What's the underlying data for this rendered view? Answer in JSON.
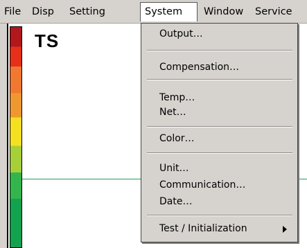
{
  "menubar": {
    "items": [
      "File",
      "Disp",
      "Setting",
      "System",
      "Window",
      "Service"
    ],
    "open_item": "System"
  },
  "display": {
    "label": "TS",
    "color_scale": [
      "#b0181c",
      "#e6301c",
      "#f07830",
      "#f09830",
      "#f4e020",
      "#a6cf3a",
      "#34b44c",
      "#13a24e"
    ],
    "trace_color": "#1ea060"
  },
  "dropdown": {
    "items": [
      "Output…",
      "Compensation…",
      "Temp…",
      "Net…",
      "Color…",
      "Unit…",
      "Communication…",
      "Date…",
      "Test / Initialization"
    ]
  }
}
